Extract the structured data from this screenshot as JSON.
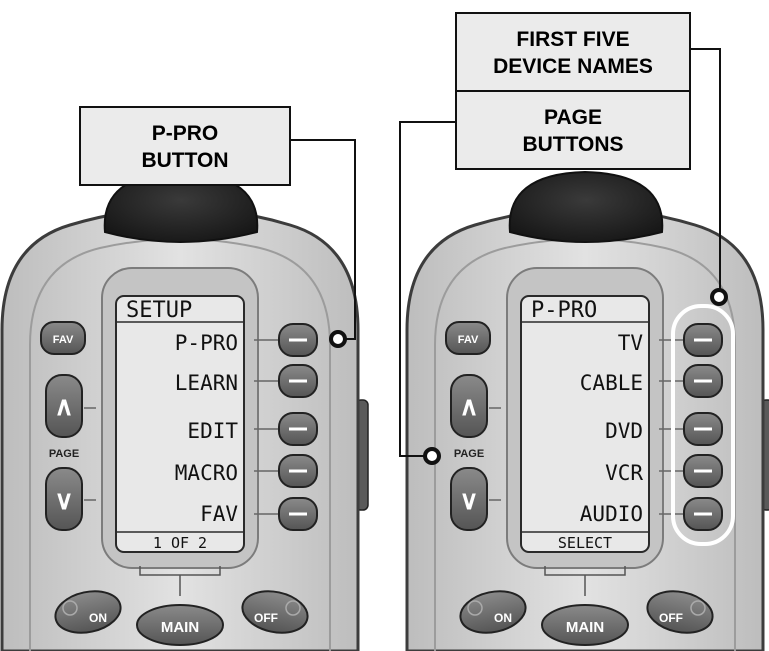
{
  "callouts": {
    "p_pro_button": [
      "P-PRO",
      "BUTTON"
    ],
    "first_five_device_names": [
      "FIRST FIVE",
      "DEVICE NAMES"
    ],
    "page_buttons": [
      "PAGE",
      "BUTTONS"
    ]
  },
  "left_remote": {
    "screen_title": "SETUP",
    "menu_items": [
      "P-PRO",
      "LEARN",
      "EDIT",
      "MACRO",
      "FAV"
    ],
    "footer": "1 OF 2"
  },
  "right_remote": {
    "screen_title": "P-PRO",
    "menu_items": [
      "TV",
      "CABLE",
      "DVD",
      "VCR",
      "AUDIO"
    ],
    "footer": "SELECT"
  },
  "buttons": {
    "fav": "FAV",
    "page": "PAGE",
    "page_up": "∧",
    "page_down": "∨",
    "on": "ON",
    "main": "MAIN",
    "off": "OFF"
  },
  "colors": {
    "body": "#d6d6d6",
    "body_edge": "#3c3c3c",
    "top_cap": "#2a2a2a",
    "lcd": "#e8e8e8",
    "button": "#6f6f6f",
    "callout_box": "#ebebeb"
  }
}
